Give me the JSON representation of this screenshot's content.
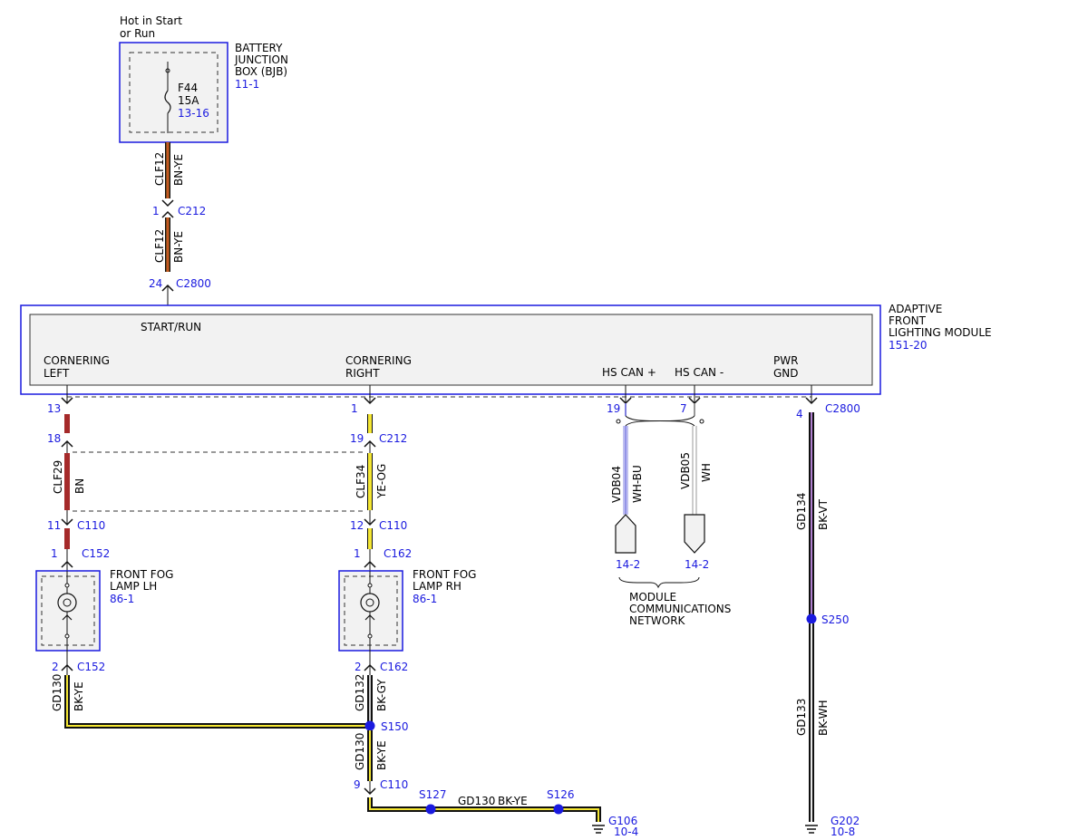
{
  "colors": {
    "blue": "#1a1adf",
    "box_fill": "#f2f2f2",
    "brown": "#a52a2a",
    "orange": "#e8841c",
    "yellow": "#f4e632",
    "black": "#111111",
    "violet": "#b080d0",
    "can_blue": "#8080e0",
    "dashed": "#333333"
  },
  "top": {
    "supply_note": [
      "Hot in Start",
      "or Run"
    ],
    "bjb": {
      "name": [
        "BATTERY",
        "JUNCTION",
        "BOX (BJB)"
      ],
      "ref": "11-1",
      "fuse": "F44",
      "rating": "15A",
      "fuse_ref": "13-16"
    },
    "wire_upper": {
      "circuit": "CLF12",
      "color": "BN-YE"
    },
    "wire_lower": {
      "circuit": "CLF12",
      "color": "BN-YE"
    },
    "c212_pin": "1",
    "c212": "C212",
    "c2800_pin": "24",
    "c2800": "C2800"
  },
  "module": {
    "name": [
      "ADAPTIVE",
      "FRONT",
      "LIGHTING MODULE"
    ],
    "ref": "151-20",
    "start_run": "START/RUN",
    "cornering_left": [
      "CORNERING",
      "LEFT"
    ],
    "cornering_right": [
      "CORNERING",
      "RIGHT"
    ],
    "hs_can_plus": "HS CAN +",
    "hs_can_minus": "HS CAN -",
    "pwr_gnd": [
      "PWR",
      "GND"
    ],
    "c2800": "C2800"
  },
  "left_branch": {
    "pin_13": "13",
    "pin_18": "18",
    "circuit": "CLF29",
    "color": "BN",
    "pin_11": "11",
    "c110": "C110",
    "pin_1": "1",
    "c152": "C152",
    "lamp": [
      "FRONT FOG",
      "LAMP LH"
    ],
    "lamp_ref": "86-1",
    "pin_2": "2",
    "c152_b": "C152",
    "ground_circuit": "GD130",
    "ground_color": "BK-YE"
  },
  "right_branch": {
    "pin_1": "1",
    "pin_19": "19",
    "c212": "C212",
    "circuit": "CLF34",
    "color": "YE-OG",
    "pin_12": "12",
    "c110": "C110",
    "pin_1b": "1",
    "c162": "C162",
    "lamp": [
      "FRONT FOG",
      "LAMP RH"
    ],
    "lamp_ref": "86-1",
    "pin_2": "2",
    "c162_b": "C162",
    "ground_circuit": "GD132",
    "ground_color": "BK-GY",
    "splice": "S150",
    "lower_circuit": "GD130",
    "lower_color": "BK-YE",
    "pin_9": "9",
    "c110_b": "C110",
    "s127": "S127",
    "bottom_circuit": "GD130",
    "bottom_color": "BK-YE",
    "s126": "S126",
    "g106": "G106",
    "g106_ref": "10-4"
  },
  "can": {
    "pin_19": "19",
    "pin_7": "7",
    "plus_circuit": "VDB04",
    "plus_color": "WH-BU",
    "minus_circuit": "VDB05",
    "minus_color": "WH",
    "plus_ref": "14-2",
    "minus_ref": "14-2",
    "network": [
      "MODULE",
      "COMMUNICATIONS",
      "NETWORK"
    ]
  },
  "ground_branch": {
    "pin_4": "4",
    "c2800": "C2800",
    "upper_circuit": "GD134",
    "upper_color": "BK-VT",
    "splice": "S250",
    "lower_circuit": "GD133",
    "lower_color": "BK-WH",
    "g202": "G202",
    "g202_ref": "10-8"
  }
}
